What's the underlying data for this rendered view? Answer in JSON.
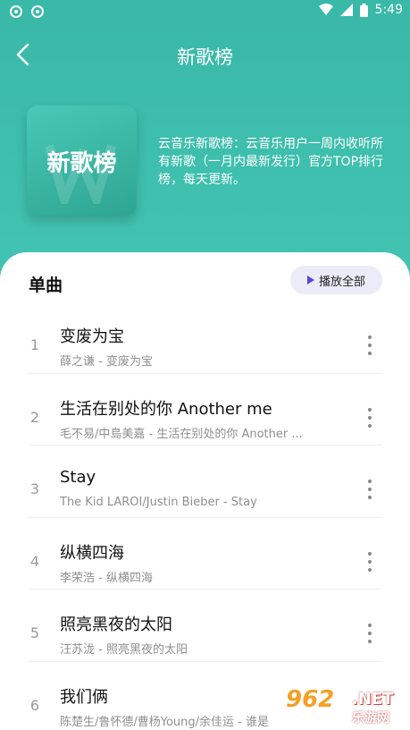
{
  "status": {
    "time": "5:49"
  },
  "header": {
    "title": "新歌榜"
  },
  "playlist": {
    "cover_title": "新歌榜",
    "description": "云音乐新歌榜：云音乐用户一周内收听所有新歌（一月内最新发行）官方TOP排行榜，每天更新。"
  },
  "section": {
    "title": "单曲",
    "play_all_label": "播放全部"
  },
  "songs": [
    {
      "num": "1",
      "title": "变废为宝",
      "subtitle": "薛之谦 - 变废为宝"
    },
    {
      "num": "2",
      "title": "生活在别处的你 Another me",
      "subtitle": "毛不易/中島美嘉 - 生活在别处的你 Another ..."
    },
    {
      "num": "3",
      "title": "Stay",
      "subtitle": "The Kid LAROI/Justin Bieber - Stay"
    },
    {
      "num": "4",
      "title": "纵横四海",
      "subtitle": "李荣浩 - 纵横四海"
    },
    {
      "num": "5",
      "title": "照亮黑夜的太阳",
      "subtitle": "汪苏泷 - 照亮黑夜的太阳"
    },
    {
      "num": "6",
      "title": "我们俩",
      "subtitle": "陈楚生/鲁怀德/曹杨Young/余佳运 - 谁是"
    }
  ],
  "watermark": {
    "number": "962",
    "domain": ".NET",
    "cn": "乐游网"
  },
  "colors": {
    "accent": "#3fbfae",
    "play_icon": "#5b45d6"
  }
}
